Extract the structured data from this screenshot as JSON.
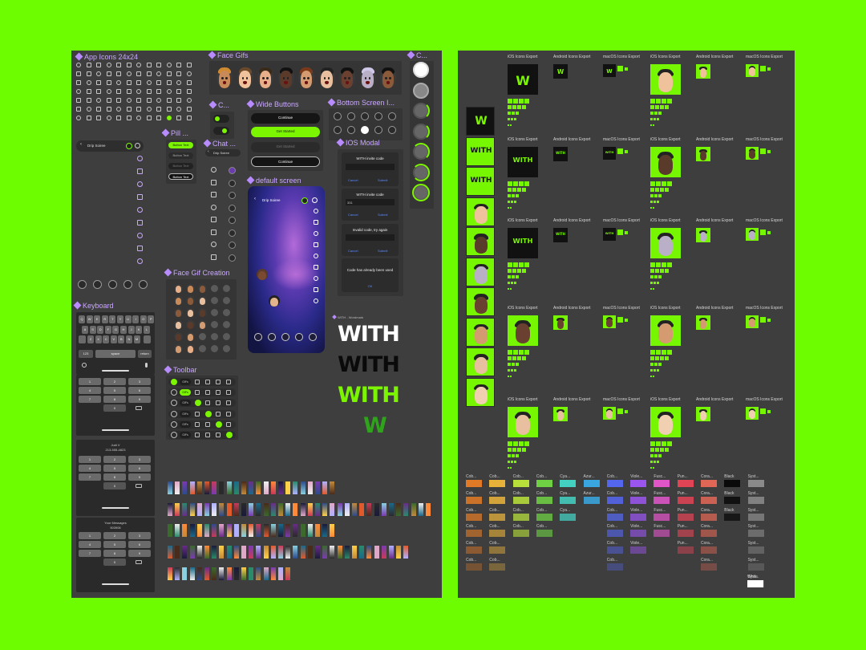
{
  "colors": {
    "background": "#6dfc00",
    "board": "#3e3e3e",
    "accent": "#7cf600",
    "label": "#c9a8ff"
  },
  "sections": {
    "app_icons": "App Icons 24x24",
    "face_gifs": "Face Gifs",
    "c_top": "C...",
    "c_mid": "C...",
    "wide_buttons": "Wide Buttons",
    "bottom_screen": "Bottom Screen I...",
    "pill": "Pill ...",
    "chat": "Chat ...",
    "ios_modal": "IOS Modal",
    "default_screen": "default screen",
    "face_gif_creation": "Face Gif Creation",
    "keyboard": "Keyboard",
    "toolbar": "Toolbar"
  },
  "header": {
    "title": "Drip Soiree",
    "chevron": "‹"
  },
  "wide_buttons": [
    "Continue",
    "Get Started",
    "Get Started",
    "Continue"
  ],
  "pill_buttons": [
    "Button Text",
    "Button Text",
    "Button Text",
    "Button Text"
  ],
  "ios_modal": {
    "title1": "WITH invite code",
    "title2": "WITH invite code",
    "title3": "Invalid code, try again",
    "cancel": "Cancel",
    "submit": "Submit",
    "code_value": "331",
    "used_msg": "Code has already been used",
    "ok": "OK"
  },
  "keyboard": {
    "rows": [
      "QWERTYUIOP",
      "ASDFGHJKL",
      "ZXCVBNM"
    ],
    "num_label": "123",
    "space": "space",
    "return_key": "return",
    "digits": [
      "1",
      "2",
      "3",
      "4",
      "5",
      "6",
      "7",
      "8",
      "9",
      "0"
    ],
    "contact_name": "Judi V",
    "phone": "213-555-4823",
    "code_caption": "Your Messages",
    "code_value": "503906"
  },
  "toolbar_label": "GIFs",
  "wordmark": {
    "text": "WITH",
    "letter": "W",
    "caption": "WITH - Wordmark"
  },
  "export_labels": {
    "ios": "iOS Icons Export",
    "android": "Android Icons Export",
    "macos": "macOS Icons Export"
  },
  "swatches": [
    {
      "name": "Cob...",
      "color": "#e07a26"
    },
    {
      "name": "Cob...",
      "color": "#e8b23a"
    },
    {
      "name": "Cob...",
      "color": "#b8e03a"
    },
    {
      "name": "Cob...",
      "color": "#6fd043"
    },
    {
      "name": "Cya...",
      "color": "#43d0c0"
    },
    {
      "name": "Azur...",
      "color": "#3aa6e0"
    },
    {
      "name": "Cob...",
      "color": "#5566ee"
    },
    {
      "name": "Viole...",
      "color": "#9a55ee"
    },
    {
      "name": "Fusc...",
      "color": "#e055c8"
    },
    {
      "name": "Pun...",
      "color": "#e04455"
    },
    {
      "name": "Cora...",
      "color": "#e06655"
    },
    {
      "name": "Black",
      "color": "#0a0a0a"
    },
    {
      "name": "Syst...",
      "color": "#8a8a8a"
    }
  ],
  "swatch_last": {
    "name": "White",
    "color": "#ffffff"
  }
}
